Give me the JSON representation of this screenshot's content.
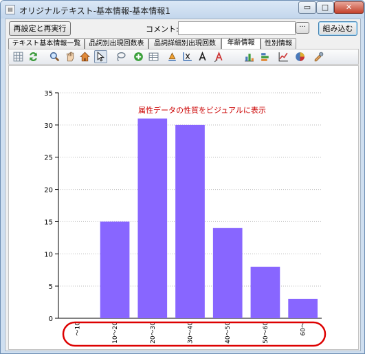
{
  "window": {
    "title": "オリジナルテキスト-基本情報-基本情報1",
    "app_icon": "document-icon",
    "min_glyph": "▭",
    "max_glyph": "□",
    "close_glyph": "✕"
  },
  "topbar": {
    "rerun_label": "再設定と再実行",
    "comment_label": "コメント:",
    "comment_value": "",
    "more_label": "···",
    "import_label": "組み込む"
  },
  "tabs": [
    {
      "label": "テキスト基本情報一覧",
      "active": false
    },
    {
      "label": "品詞別出現回数表",
      "active": false
    },
    {
      "label": "品詞詳細別出現回数",
      "active": false
    },
    {
      "label": "年齢情報",
      "active": true
    },
    {
      "label": "性別情報",
      "active": false
    }
  ],
  "toolbar": [
    "grid-icon",
    "refresh-icon",
    "zoom-icon",
    "pan-hand-icon",
    "home-icon",
    "pointer-icon",
    "lasso-icon",
    "add-icon",
    "table-icon",
    "point-label-icon",
    "axis-label-icon",
    "text-icon",
    "annotation-icon",
    "bar-chart-icon",
    "stacked-bar-icon",
    "line-chart-icon",
    "pie-chart-icon",
    "settings-icon"
  ],
  "colors": {
    "bar": "#8866ff",
    "annotation": "#cc0000",
    "highlight_ellipse": "#dd0000"
  },
  "chart_data": {
    "type": "bar",
    "title": "",
    "annotation": "属性データの性質をビジュアルに表示",
    "xlabel": "",
    "ylabel": "",
    "categories": [
      "～10",
      "10～20",
      "20～30",
      "30～40",
      "40～50",
      "50～60",
      "60～"
    ],
    "values": [
      0,
      15,
      31,
      30,
      14,
      8,
      3
    ],
    "ylim": [
      0,
      35
    ],
    "yticks": [
      0,
      5,
      10,
      15,
      20,
      25,
      30,
      35
    ],
    "grid": "horizontal-dotted",
    "legend": "none"
  }
}
